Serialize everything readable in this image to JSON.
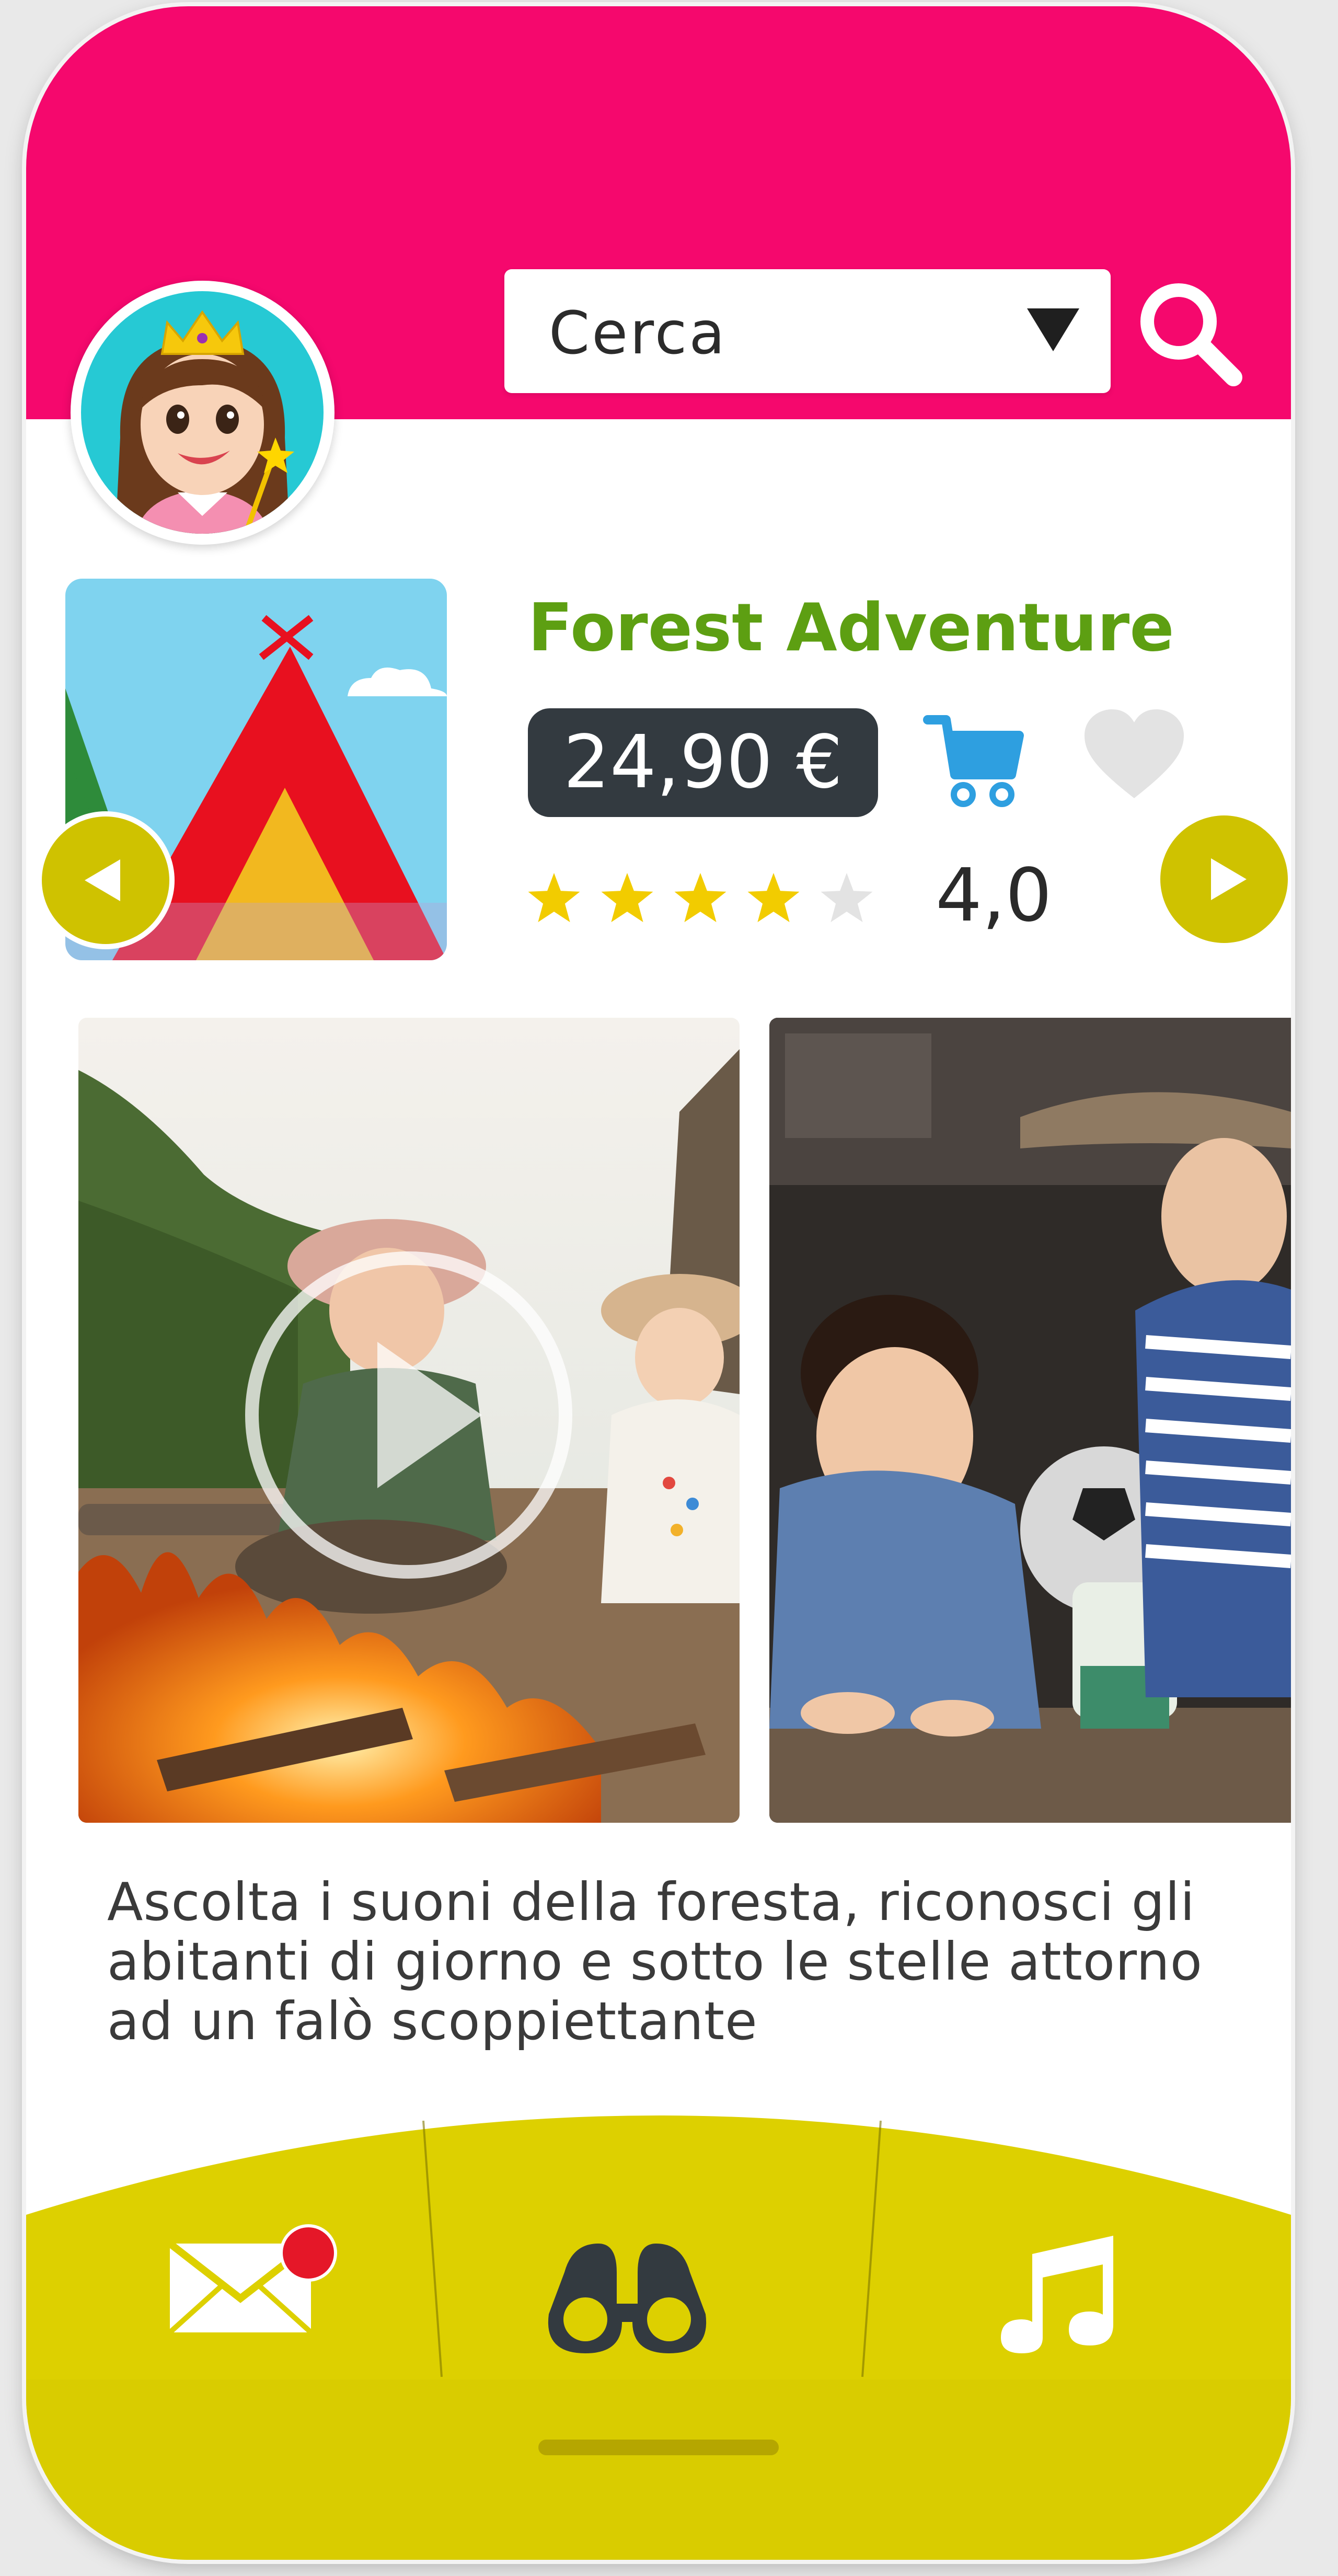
{
  "colors": {
    "header": "#f5086d",
    "footer": "#ddd000",
    "title": "#5d9f12",
    "price_bg": "#333a40",
    "cart": "#2e9fe0",
    "star_active": "#f2cc00",
    "star_inactive": "#e3e3e3",
    "nav_button": "#cfc200",
    "badge": "#e51728"
  },
  "header": {
    "search": {
      "label": "Cerca",
      "dropdown_icon": "triangle-down-icon"
    },
    "search_icon": "search-icon",
    "avatar": "princess-avatar"
  },
  "product": {
    "title": "Forest Adventure",
    "price": "24,90 €",
    "rating": {
      "value_text": "4,0",
      "stars_filled": 4,
      "stars_total": 5
    },
    "icons": {
      "cart": "cart-icon",
      "favorite": "heart-icon",
      "prev": "arrow-left-icon",
      "next": "arrow-right-icon"
    },
    "description": "Ascolta i suoni della foresta, riconosci gli abitanti di giorno e sotto le stelle attorno ad un falò scoppiettante"
  },
  "media": [
    {
      "kind": "video",
      "icon": "play-icon"
    },
    {
      "kind": "image"
    }
  ],
  "tabs": [
    {
      "id": "messages",
      "icon": "mail-icon",
      "badge": true
    },
    {
      "id": "explore",
      "icon": "binoculars-icon",
      "active": true
    },
    {
      "id": "music",
      "icon": "music-note-icon"
    }
  ]
}
